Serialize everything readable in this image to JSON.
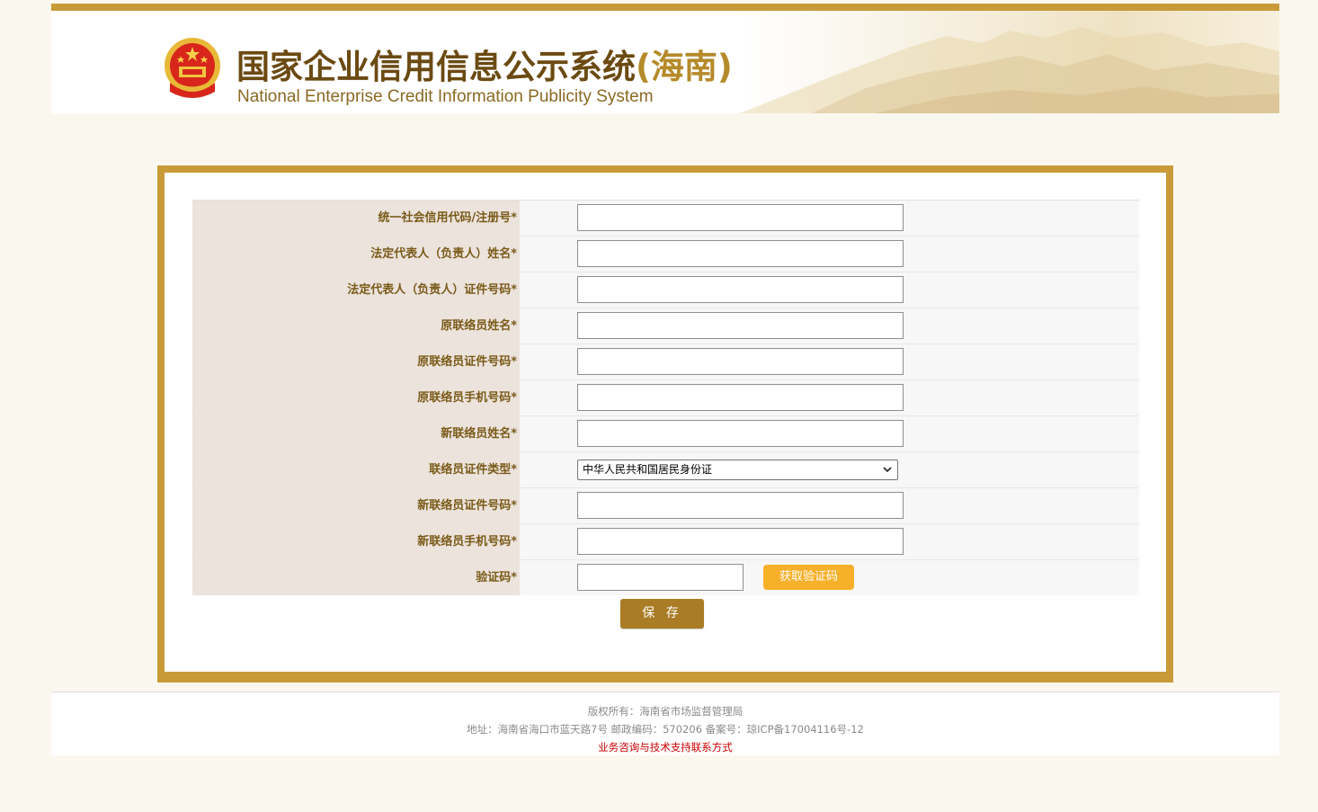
{
  "header": {
    "title_cn": "国家企业信用信息公示系统",
    "title_region": "(海南)",
    "title_en": "National Enterprise Credit Information Publicity System"
  },
  "form": {
    "rows": [
      {
        "label": "统一社会信用代码/注册号*",
        "value": "",
        "type": "text"
      },
      {
        "label": "法定代表人（负责人）姓名*",
        "value": "",
        "type": "text"
      },
      {
        "label": "法定代表人（负责人）证件号码*",
        "value": "",
        "type": "text"
      },
      {
        "label": "原联络员姓名*",
        "value": "",
        "type": "text"
      },
      {
        "label": "原联络员证件号码*",
        "value": "",
        "type": "text"
      },
      {
        "label": "原联络员手机号码*",
        "value": "",
        "type": "text"
      },
      {
        "label": "新联络员姓名*",
        "value": "",
        "type": "text"
      },
      {
        "label": "联络员证件类型*",
        "value": "中华人民共和国居民身份证",
        "type": "select"
      },
      {
        "label": "新联络员证件号码*",
        "value": "",
        "type": "text"
      },
      {
        "label": "新联络员手机号码*",
        "value": "",
        "type": "text"
      },
      {
        "label": "验证码*",
        "value": "",
        "type": "code"
      }
    ],
    "get_code_label": "获取验证码",
    "save_label": "保 存"
  },
  "footer": {
    "copyright": "版权所有：海南省市场监督管理局",
    "address": "地址：海南省海口市蓝天路7号 邮政编码：570206 备案号：琼ICP备17004116号-12",
    "contact": "业务咨询与技术支持联系方式"
  },
  "colors": {
    "accent_gold": "#c89a38",
    "label_bg": "#ebe3dc",
    "label_text": "#7a5a18",
    "sms_button": "#f7b02a",
    "save_button": "#a97c25",
    "contact_link": "#cc0000"
  },
  "icons": [
    "national-emblem-icon",
    "chevron-down-icon"
  ]
}
